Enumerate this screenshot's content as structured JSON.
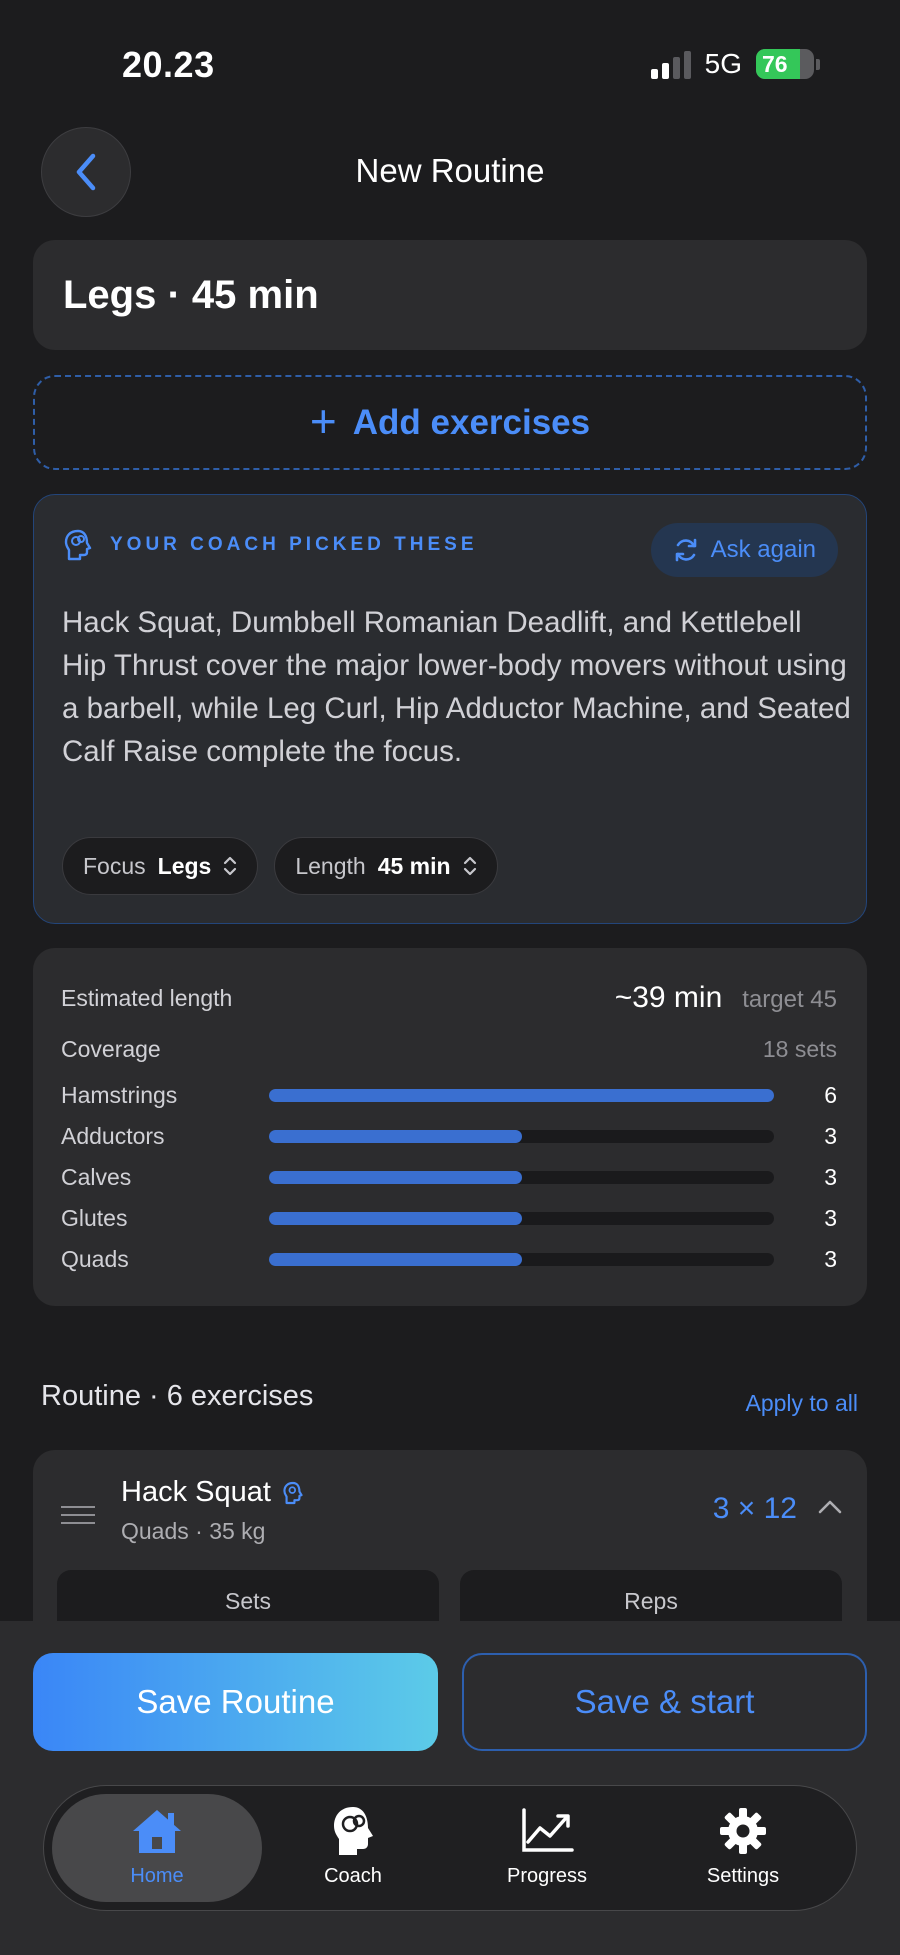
{
  "status": {
    "time": "20.23",
    "network": "5G",
    "battery": "76"
  },
  "header": {
    "title": "New Routine"
  },
  "routine": {
    "name": "Legs · 45 min"
  },
  "add_exercises": {
    "plus": "+",
    "label": "Add exercises"
  },
  "coach": {
    "heading": "YOUR COACH PICKED THESE",
    "ask_again": "Ask again",
    "text": "Hack Squat, Dumbbell Romanian Deadlift, and Kettlebell Hip Thrust cover the major lower-body movers without using a barbell, while Leg Curl, Hip Adductor Machine, and Seated Calf Raise complete the focus.",
    "focus": {
      "label": "Focus",
      "value": "Legs"
    },
    "length": {
      "label": "Length",
      "value": "45 min"
    }
  },
  "estimate": {
    "label": "Estimated length",
    "value": "~39 min",
    "target": "target 45",
    "coverage_label": "Coverage",
    "coverage_total": "18 sets",
    "max_sets": 6,
    "muscles": [
      {
        "name": "Hamstrings",
        "sets": 6
      },
      {
        "name": "Adductors",
        "sets": 3
      },
      {
        "name": "Calves",
        "sets": 3
      },
      {
        "name": "Glutes",
        "sets": 3
      },
      {
        "name": "Quads",
        "sets": 3
      }
    ]
  },
  "routine_list": {
    "heading": "Routine · 6 exercises",
    "apply_all": "Apply to all",
    "exercise": {
      "name": "Hack Squat",
      "subtitle": "Quads · 35 kg",
      "sets_reps": "3 × 12",
      "col_sets": "Sets",
      "col_reps": "Reps"
    }
  },
  "actions": {
    "save": "Save Routine",
    "save_start": "Save & start"
  },
  "tabs": [
    {
      "label": "Home",
      "icon": "home-icon"
    },
    {
      "label": "Coach",
      "icon": "brain-head-icon"
    },
    {
      "label": "Progress",
      "icon": "chart-icon"
    },
    {
      "label": "Settings",
      "icon": "gear-icon"
    }
  ],
  "colors": {
    "accent": "#4b8df8",
    "background": "#1c1c1e",
    "card": "#2c2c2e",
    "bar": "#3a6fd0"
  }
}
